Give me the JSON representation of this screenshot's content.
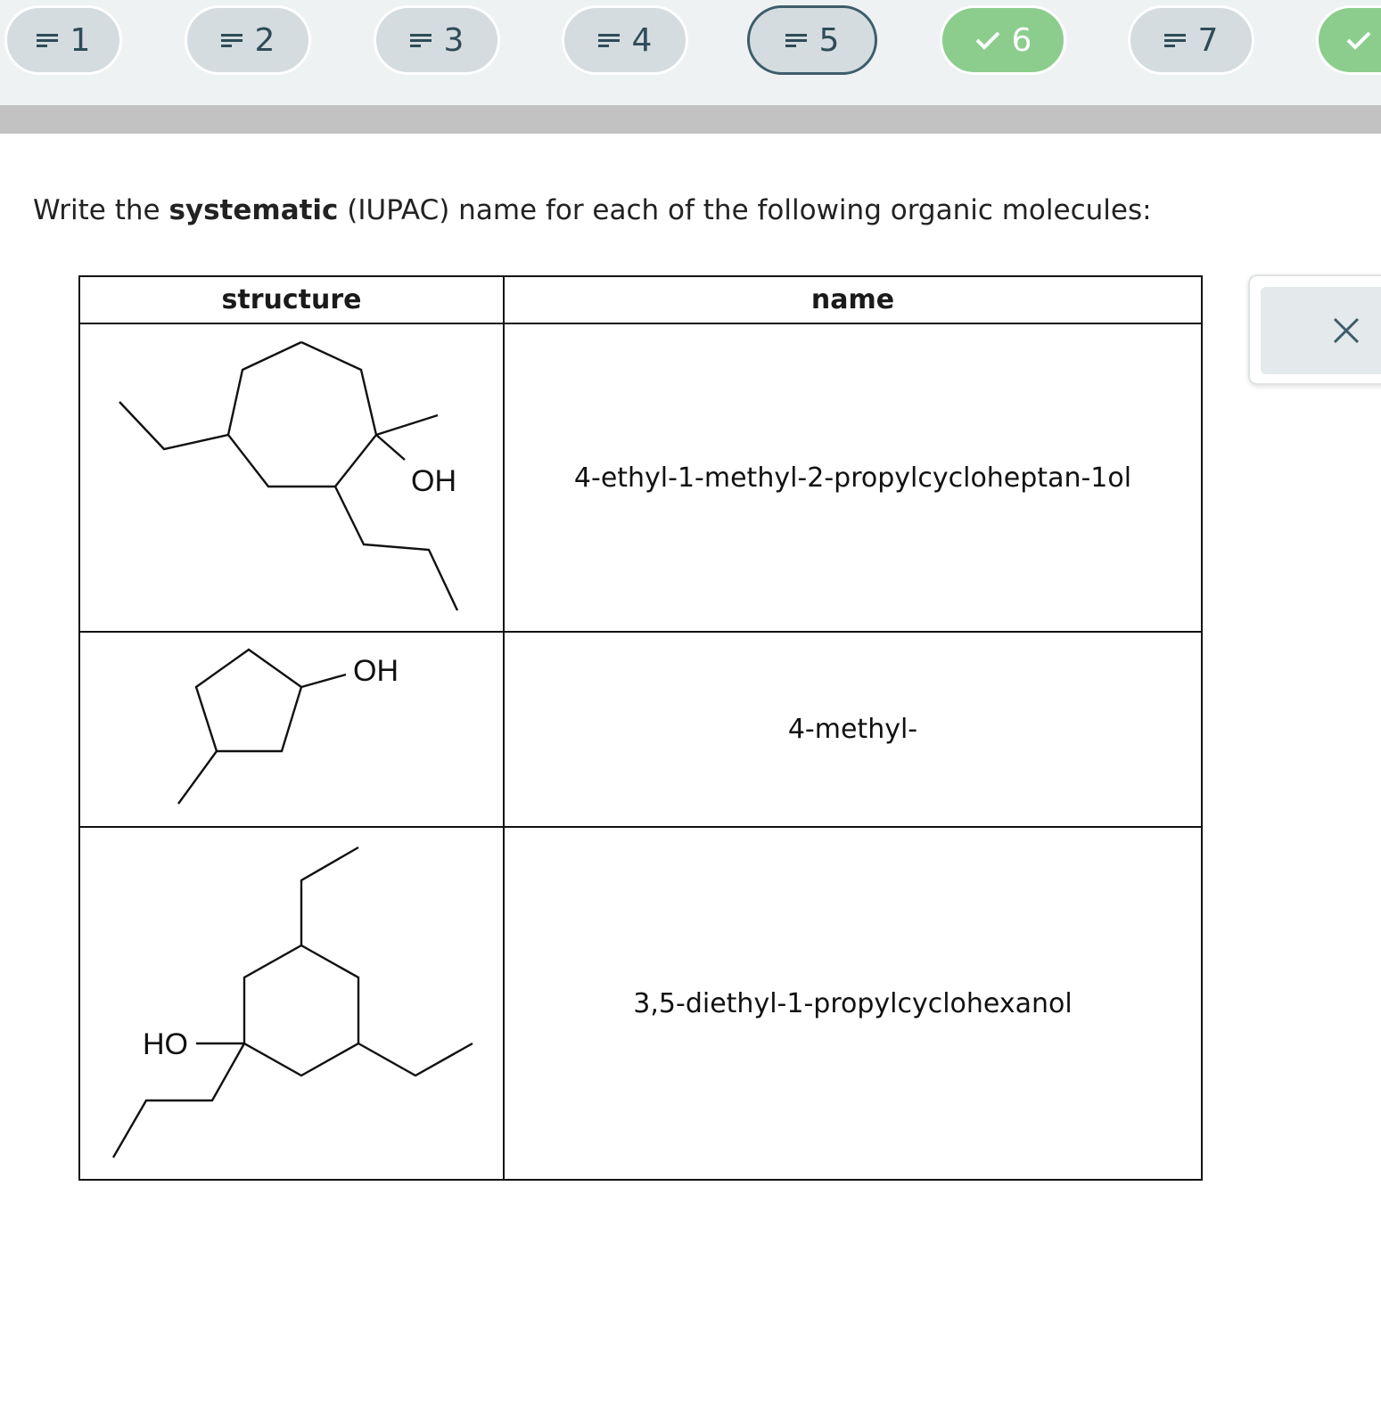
{
  "nav": {
    "items": [
      {
        "number": "1",
        "state": "pending",
        "icon": "lines-icon"
      },
      {
        "number": "2",
        "state": "pending",
        "icon": "lines-icon"
      },
      {
        "number": "3",
        "state": "pending",
        "icon": "lines-icon"
      },
      {
        "number": "4",
        "state": "pending",
        "icon": "lines-icon"
      },
      {
        "number": "5",
        "state": "current",
        "icon": "lines-icon"
      },
      {
        "number": "6",
        "state": "done",
        "icon": "check-icon"
      },
      {
        "number": "7",
        "state": "pending",
        "icon": "lines-icon"
      },
      {
        "number": "",
        "state": "done",
        "icon": "check-icon"
      }
    ],
    "colors": {
      "pending": "#d4dcdf",
      "current_border": "#3e5d6b",
      "done": "#8ccd8e",
      "text": "#2f4b57"
    }
  },
  "question": {
    "prompt_before": "Write the ",
    "prompt_bold": "systematic",
    "prompt_after": " (IUPAC) name for each of the following organic molecules:"
  },
  "table": {
    "headers": {
      "structure": "structure",
      "name": "name"
    },
    "rows": [
      {
        "structure_label": "OH",
        "name": "4-ethyl-1-methyl-2-propylcycloheptan-1ol"
      },
      {
        "structure_label": "OH",
        "name": "4-methyl-"
      },
      {
        "structure_label": "HO",
        "name": "3,5-diethyl-1-propylcyclohexanol"
      }
    ]
  },
  "side_panel": {
    "close_icon": "close-icon"
  }
}
